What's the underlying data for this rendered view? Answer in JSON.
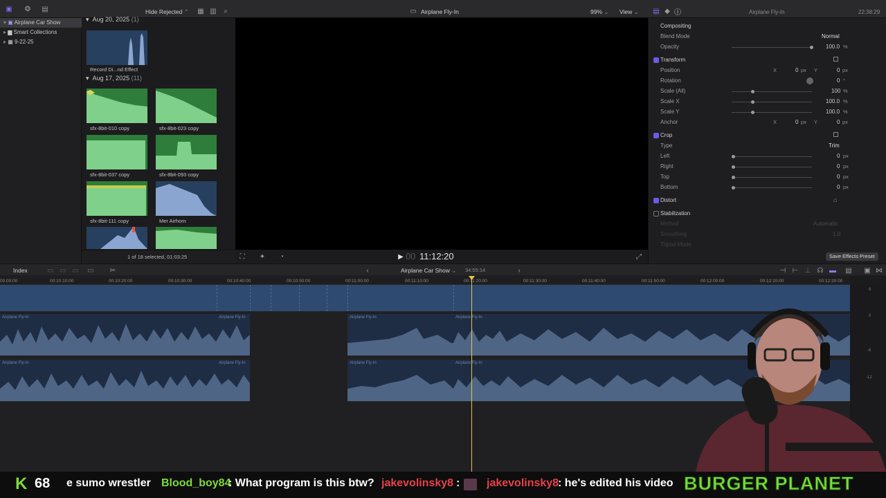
{
  "toolbar": {
    "filter": "Hide Rejected",
    "title": "Airplane Fly-In",
    "zoom": "99%",
    "view": "View",
    "inspector_title": "Airplane Fly-In",
    "time": "22:38:29"
  },
  "sidebar": {
    "items": [
      {
        "label": "Airplane Car Show"
      },
      {
        "label": "Smart Collections"
      },
      {
        "label": "9-22-25"
      }
    ]
  },
  "browser": {
    "groups": [
      {
        "date": "Aug 20, 2025",
        "count": "(1)"
      },
      {
        "date": "Aug 17, 2025",
        "count": "(11)"
      }
    ],
    "clips": [
      {
        "label": "Record Di...nd Effect"
      },
      {
        "label": "sfx-8bit-010 copy"
      },
      {
        "label": "sfx-8bit-023 copy"
      },
      {
        "label": "sfx-8bit-037 copy"
      },
      {
        "label": "sfx-8bit-093 copy"
      },
      {
        "label": "sfx-8bit-111 copy"
      },
      {
        "label": "Mer Airhorn"
      }
    ],
    "status": "1 of 18 selected, 01:03:25"
  },
  "viewer": {
    "timecode_dim": "00",
    "timecode": "11:12:20"
  },
  "inspector": {
    "compositing": "Compositing",
    "blend_mode_label": "Blend Mode",
    "blend_mode_value": "Normal",
    "opacity_label": "Opacity",
    "opacity_value": "100.0",
    "percent": "%",
    "transform": "Transform",
    "position_label": "Position",
    "x": "X",
    "y": "Y",
    "zero": "0",
    "px": "px",
    "rotation_label": "Rotation",
    "degree": "°",
    "scale_all_label": "Scale (All)",
    "scale_all_value": "100",
    "scale_x_label": "Scale X",
    "scale_x_value": "100.0",
    "scale_y_label": "Scale Y",
    "scale_y_value": "100.0",
    "anchor_label": "Anchor",
    "crop": "Crop",
    "type_label": "Type",
    "type_value": "Trim",
    "left_label": "Left",
    "right_label": "Right",
    "top_label": "Top",
    "bottom_label": "Bottom",
    "distort": "Distort",
    "stabilization": "Stabilization",
    "method_label": "Method",
    "method_value": "Automatic",
    "smoothing_label": "Smoothing",
    "smoothing_value": "1.0",
    "tripod_label": "Tripod Mode",
    "save_preset": "Save Effects Preset"
  },
  "timeline": {
    "index": "Index",
    "project": "Airplane Car Show",
    "duration": "34:55:14",
    "ticks": [
      "00:00:00",
      "00:10:10:00",
      "00:10:20:00",
      "00:10:30:00",
      "00:10:40:00",
      "00:10:50:00",
      "00:11:00:00",
      "00:11:10:00",
      "00:11:20:00",
      "00:11:30:00",
      "00:11:40:00",
      "00:11:50:00",
      "00:12:00:00",
      "00:12:10:00",
      "00:12:20:00"
    ],
    "clip_name": "Airplane Fly-In",
    "meter_labels": [
      "6",
      "0",
      "-6",
      "-12"
    ]
  },
  "overlay": {
    "k_count": "68",
    "chat": [
      {
        "text": "e sumo wrestler",
        "color": "#ffffff"
      },
      {
        "text": "Blood_boy84",
        "color": "#7ddc3a"
      },
      {
        "text": ": What program is this btw?",
        "color": "#ffffff"
      },
      {
        "text": "jakevolinsky8",
        "color": "#e8414a"
      },
      {
        "text": ":",
        "color": "#ffffff"
      },
      {
        "text": "jakevolinsky8",
        "color": "#e8414a"
      },
      {
        "text": ": he's edited his video",
        "color": "#ffffff"
      }
    ],
    "brand": "BURGER PLANET",
    "brand_color": "#7ddc3a"
  }
}
